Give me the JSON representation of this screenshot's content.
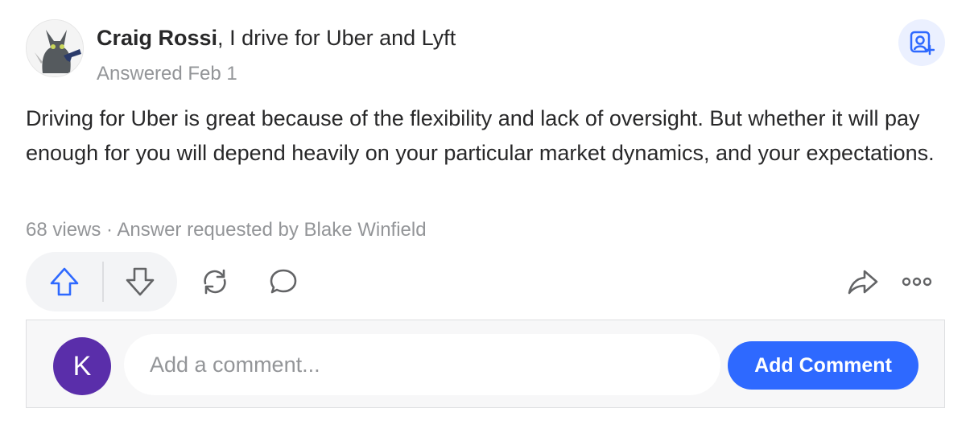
{
  "answer": {
    "author": {
      "name": "Craig Rossi",
      "separator": ", ",
      "credential": "I drive for Uber and Lyft",
      "answered_date": "Answered Feb 1",
      "avatar_icon": "cat-with-gun-avatar"
    },
    "follow_icon": "add-person-icon",
    "body": "Driving for Uber is great because of the flexibility and lack of oversight. But whether it will pay enough for you will depend heavily on your particular market dynamics, and your expectations.",
    "meta": {
      "views": "68 views",
      "separator": " · ",
      "requested_by": "Answer requested by Blake Winfield"
    },
    "actions": {
      "upvote_icon": "upvote-arrow-icon",
      "downvote_icon": "downvote-arrow-icon",
      "share_icon": "reshare-icon",
      "comment_icon": "comment-bubble-icon",
      "forward_icon": "forward-share-icon",
      "more_icon": "more-options-icon"
    },
    "colors": {
      "accent": "#2e69ff",
      "muted": "#939598",
      "text": "#282829",
      "user_avatar": "#5a2eaa"
    }
  },
  "comment_bar": {
    "user_initial": "K",
    "placeholder": "Add a comment...",
    "button_label": "Add Comment"
  }
}
